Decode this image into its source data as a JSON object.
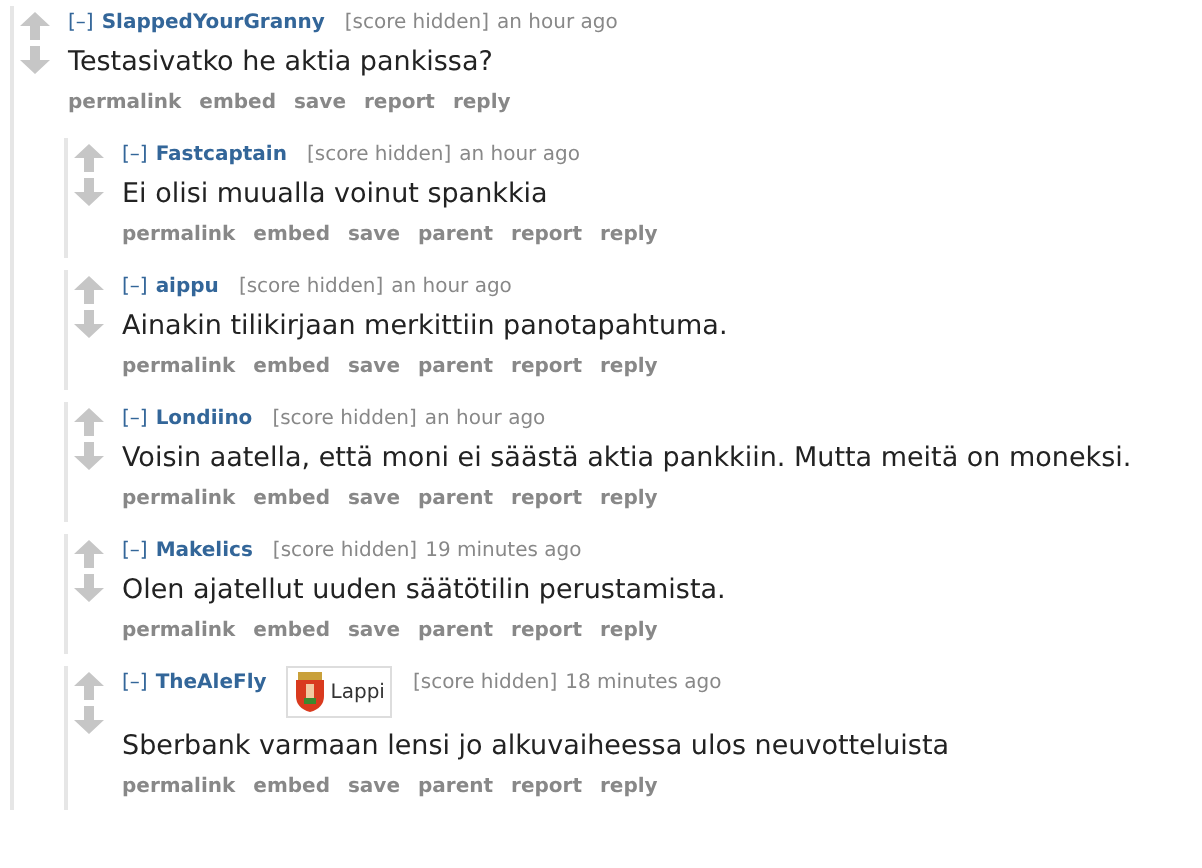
{
  "comment": {
    "author": "SlappedYourGranny",
    "collapse": "[–]",
    "score": "[score hidden]",
    "time": "an hour ago",
    "body": "Testasivatko he aktia pankissa?",
    "actions": [
      "permalink",
      "embed",
      "save",
      "report",
      "reply"
    ],
    "children": [
      {
        "author": "Fastcaptain",
        "collapse": "[–]",
        "score": "[score hidden]",
        "time": "an hour ago",
        "body": "Ei olisi muualla voinut spankkia",
        "actions": [
          "permalink",
          "embed",
          "save",
          "parent",
          "report",
          "reply"
        ]
      },
      {
        "author": "aippu",
        "collapse": "[–]",
        "score": "[score hidden]",
        "time": "an hour ago",
        "body": "Ainakin tilikirjaan merkittiin panotapahtuma.",
        "actions": [
          "permalink",
          "embed",
          "save",
          "parent",
          "report",
          "reply"
        ]
      },
      {
        "author": "Londiino",
        "collapse": "[–]",
        "score": "[score hidden]",
        "time": "an hour ago",
        "body": "Voisin aatella, että moni ei säästä aktia pankkiin. Mutta meitä on moneksi.",
        "actions": [
          "permalink",
          "embed",
          "save",
          "parent",
          "report",
          "reply"
        ]
      },
      {
        "author": "Makelics",
        "collapse": "[–]",
        "score": "[score hidden]",
        "time": "19 minutes ago",
        "body": "Olen ajatellut uuden säätötilin perustamista.",
        "actions": [
          "permalink",
          "embed",
          "save",
          "parent",
          "report",
          "reply"
        ]
      },
      {
        "author": "TheAleFly",
        "collapse": "[–]",
        "flair": "Lappi",
        "score": "[score hidden]",
        "time": "18 minutes ago",
        "body": "Sberbank varmaan lensi jo alkuvaiheessa ulos neuvotteluista",
        "actions": [
          "permalink",
          "embed",
          "save",
          "parent",
          "report",
          "reply"
        ]
      }
    ]
  }
}
